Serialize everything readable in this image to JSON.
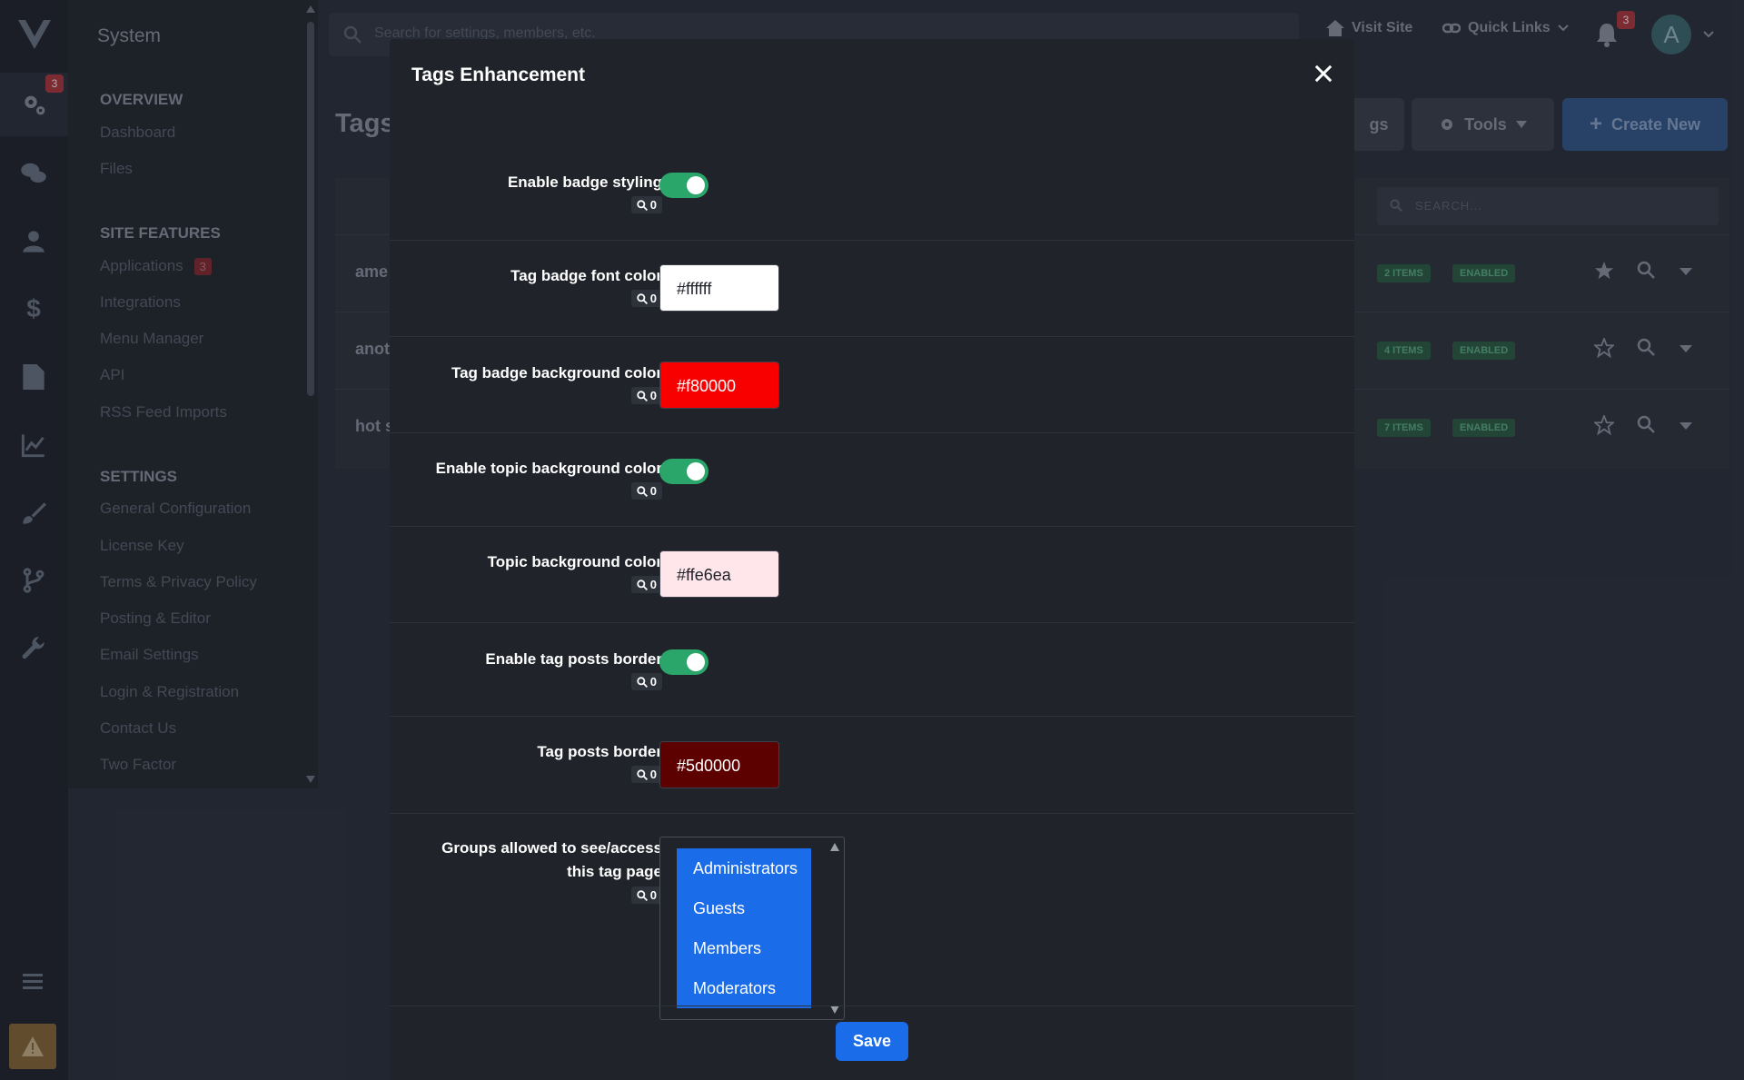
{
  "app": {
    "section_title": "System",
    "alerts_badge": "3"
  },
  "sidebar": {
    "sections": [
      {
        "heading": "OVERVIEW",
        "items": [
          "Dashboard",
          "Files"
        ]
      },
      {
        "heading": "SITE FEATURES",
        "items": [
          "Applications",
          "Integrations",
          "Menu Manager",
          "API",
          "RSS Feed Imports"
        ]
      },
      {
        "heading": "SETTINGS",
        "items": [
          "General Configuration",
          "License Key",
          "Terms & Privacy Policy",
          "Posting & Editor",
          "Email Settings",
          "Login & Registration",
          "Contact Us",
          "Two Factor"
        ]
      }
    ],
    "applications_badge": "3"
  },
  "header": {
    "search_placeholder": "Search for settings, members, etc.",
    "visit_site": "Visit Site",
    "quick_links": "Quick Links",
    "notifications_badge": "3",
    "avatar_letter": "A"
  },
  "page": {
    "title": "Tags",
    "tags_button": "gs",
    "tools_button": "Tools",
    "create_button": "Create New",
    "table_search_placeholder": "SEARCH...",
    "rows": [
      {
        "name": "ame",
        "items": "2 ITEMS",
        "status": "ENABLED",
        "starred": true
      },
      {
        "name": "anot",
        "items": "4 ITEMS",
        "status": "ENABLED",
        "starred": false
      },
      {
        "name": "hot s",
        "items": "7 ITEMS",
        "status": "ENABLED",
        "starred": false
      }
    ]
  },
  "modal": {
    "title": "Tags Enhancement",
    "fields": [
      {
        "label": "Enable badge styling",
        "count": "0",
        "type": "toggle",
        "value": true
      },
      {
        "label": "Tag badge font color",
        "count": "0",
        "type": "color",
        "value": "#ffffff"
      },
      {
        "label": "Tag badge background color",
        "count": "0",
        "type": "color",
        "value": "#f80000"
      },
      {
        "label": "Enable topic background color",
        "count": "0",
        "type": "toggle",
        "value": true
      },
      {
        "label": "Topic background color",
        "count": "0",
        "type": "color",
        "value": "#ffe6ea"
      },
      {
        "label": "Enable tag posts border",
        "count": "0",
        "type": "toggle",
        "value": true
      },
      {
        "label": "Tag posts border",
        "count": "0",
        "type": "color",
        "value": "#5d0000"
      },
      {
        "label_line1": "Groups allowed to see/access",
        "label_line2": "this tag page",
        "count": "0",
        "type": "multiselect",
        "options": [
          "Administrators",
          "Guests",
          "Members",
          "Moderators"
        ]
      }
    ],
    "save_label": "Save"
  },
  "colors": {
    "accent": "#1a6ce8",
    "toggle_on": "#2aa66a",
    "badge_red": "#b6373e"
  }
}
